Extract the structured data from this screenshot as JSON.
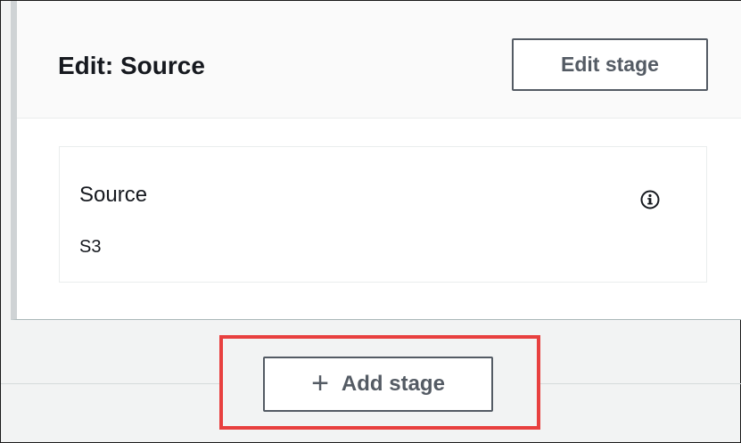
{
  "stage": {
    "title": "Edit: Source",
    "edit_stage_label": "Edit stage",
    "action": {
      "name": "Source",
      "provider": "S3",
      "info_icon": "info-circle-icon"
    }
  },
  "add_stage": {
    "label": "Add stage",
    "icon": "plus-icon"
  },
  "colors": {
    "highlight": "#e8403f",
    "button_border": "#545b64",
    "text": "#16191f"
  }
}
